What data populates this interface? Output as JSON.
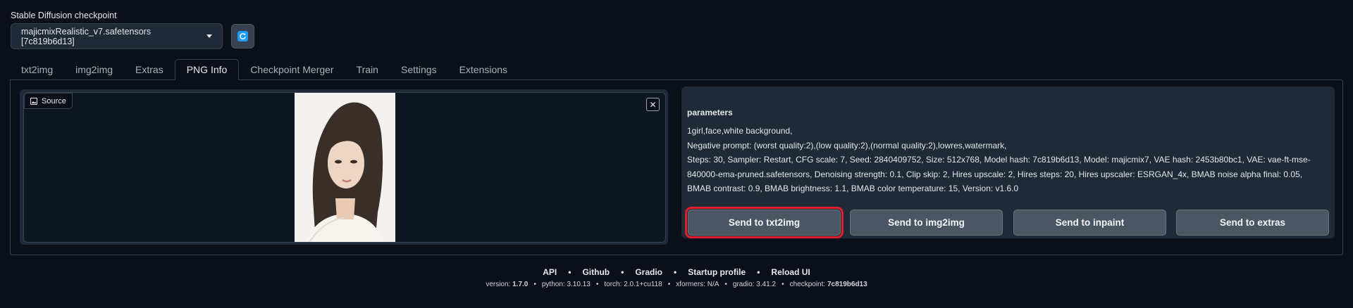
{
  "checkpoint": {
    "label": "Stable Diffusion checkpoint",
    "selected": "majicmixRealistic_v7.safetensors [7c819b6d13]"
  },
  "tabs": [
    {
      "label": "txt2img"
    },
    {
      "label": "img2img"
    },
    {
      "label": "Extras"
    },
    {
      "label": "PNG Info"
    },
    {
      "label": "Checkpoint Merger"
    },
    {
      "label": "Train"
    },
    {
      "label": "Settings"
    },
    {
      "label": "Extensions"
    }
  ],
  "active_tab": "PNG Info",
  "image_panel": {
    "source_label": "Source",
    "close_glyph": "✕"
  },
  "parameters": {
    "title": "parameters",
    "prompt": "1girl,face,white background,",
    "negative": "Negative prompt: (worst quality:2),(low quality:2),(normal quality:2),lowres,watermark,",
    "settings": "Steps: 30, Sampler: Restart, CFG scale: 7, Seed: 2840409752, Size: 512x768, Model hash: 7c819b6d13, Model: majicmix7, VAE hash: 2453b80bc1, VAE: vae-ft-mse-840000-ema-pruned.safetensors, Denoising strength: 0.1, Clip skip: 2, Hires upscale: 2, Hires steps: 20, Hires upscaler: ESRGAN_4x, BMAB noise alpha final: 0.05, BMAB contrast: 0.9, BMAB brightness: 1.1, BMAB color temperature: 15, Version: v1.6.0"
  },
  "send_buttons": {
    "txt2img": "Send to txt2img",
    "img2img": "Send to img2img",
    "inpaint": "Send to inpaint",
    "extras": "Send to extras"
  },
  "footer": {
    "links": [
      "API",
      "Github",
      "Gradio",
      "Startup profile",
      "Reload UI"
    ],
    "versions": {
      "version_label": "version:",
      "version": "1.7.0",
      "python_label": "python:",
      "python": "3.10.13",
      "torch_label": "torch:",
      "torch": "2.0.1+cu118",
      "xformers_label": "xformers:",
      "xformers": "N/A",
      "gradio_label": "gradio:",
      "gradio": "3.41.2",
      "checkpoint_label": "checkpoint:",
      "checkpoint": "7c819b6d13"
    }
  },
  "colors": {
    "background": "#0b0f19",
    "panel": "#1f2937",
    "button": "#4b5563",
    "highlight": "#e11d2b",
    "refresh_accent": "#1d9bf0"
  }
}
